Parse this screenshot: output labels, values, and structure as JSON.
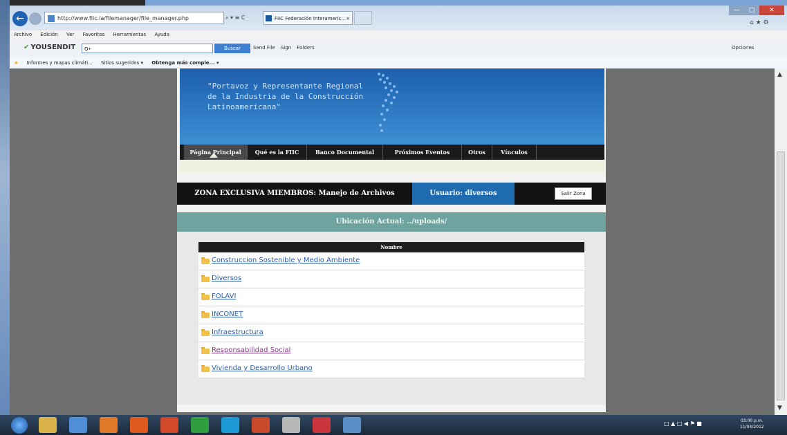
{
  "browser": {
    "address": "http://www.fiic.la/filemanager/file_manager.php",
    "address_tools": "⌕ ▾ ≡ C",
    "tab_title": "FIIC Federación Interameric...",
    "tab_close": "×",
    "window_controls": {
      "min": "—",
      "max": "□",
      "close": "✕"
    },
    "toolbar_icons": "⌂ ★ ⚙",
    "menu": [
      "Archivo",
      "Edición",
      "Ver",
      "Favoritos",
      "Herramientas",
      "Ayuda"
    ],
    "yousendit": {
      "logo": "YOUSENDIT",
      "search_value": "Q•",
      "search_button": "Buscar",
      "links": [
        "Send File",
        "Sign",
        "Folders"
      ],
      "options": "Opciones"
    },
    "favorites": [
      "Informes y mapas climáti...",
      "Sitios sugeridos ▾",
      "Obtenga más comple... ▾"
    ],
    "scroll": {
      "up": "▲",
      "down": "▼"
    }
  },
  "site": {
    "tagline": "\"Portavoz y Representante Regional de la Industria de la Construcción Latinoamericana\"",
    "nav": [
      "Página Principal",
      "Qué es la FIIC",
      "Banco Documental",
      "Próximos Eventos",
      "Otros",
      "Vínculos"
    ],
    "zone_title": "ZONA EXCLUSIVA MIEMBROS: Manejo de Archivos",
    "user_label": "Usuario: diversos",
    "logout_button": "Salir Zona",
    "location": "Ubicación Actual: ../uploads/",
    "table_header": "Nombre",
    "folders": [
      "Construccion Sostenible y Medio Ambiente",
      "Diversos",
      "FOLAVI",
      "INCONET",
      "Infraestructura",
      "Responsabilidad Social",
      "Vivienda y Desarrollo Urbano"
    ]
  },
  "taskbar": {
    "tray": "□ ▲ □ ◀ ⚑ ■",
    "time": "03:00 p.m.",
    "date": "11/04/2012"
  },
  "colors": {
    "banner": "#2f7bc4",
    "nav_bg": "#1a1a1a",
    "user_bar": "#1e6bb0",
    "location_bar": "#6fa3a0",
    "link": "#2e5ea8"
  }
}
